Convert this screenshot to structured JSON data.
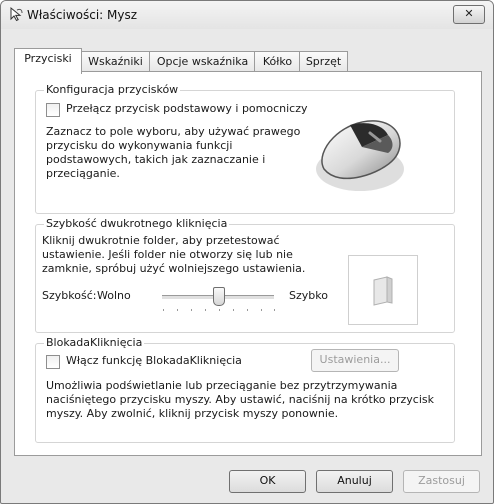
{
  "window": {
    "title": "Właściwości: Mysz",
    "close_label": "✕",
    "icon": "mouse-pointer-icon"
  },
  "tabs": [
    {
      "label": "Przyciski",
      "active": true
    },
    {
      "label": "Wskaźniki",
      "active": false
    },
    {
      "label": "Opcje wskaźnika",
      "active": false
    },
    {
      "label": "Kółko",
      "active": false
    },
    {
      "label": "Sprzęt",
      "active": false
    }
  ],
  "button_config": {
    "legend": "Konfiguracja przycisków",
    "checkbox_label": "Przełącz przycisk podstawowy i pomocniczy",
    "checked": false,
    "description_lines": [
      "Zaznacz to pole wyboru, aby używać prawego",
      "przycisku do wykonywania funkcji",
      "podstawowych, takich jak zaznaczanie i",
      "przeciąganie."
    ],
    "image": "mouse-icon"
  },
  "double_click": {
    "legend": "Szybkość dwukrotnego kliknięcia",
    "description_lines": [
      "Kliknij dwukrotnie folder, aby przetestować",
      "ustawienie. Jeśli folder nie otworzy się lub nie",
      "zamknie, spróbuj użyć wolniejszego ustawienia."
    ],
    "speed_label": "Szybkość:",
    "slow_label": "Wolno",
    "fast_label": "Szybko",
    "slider_value": 0.5,
    "test_icon": "folder-icon"
  },
  "click_lock": {
    "legend": "BlokadaKliknięcia",
    "checkbox_label": "Włącz funkcję BlokadaKliknięcia",
    "checked": false,
    "settings_label": "Ustawienia...",
    "description_lines": [
      "Umożliwia podświetlanie lub przeciąganie bez przytrzymywania",
      "naciśniętego przycisku myszy. Aby ustawić, naciśnij na krótko przycisk",
      "myszy. Aby zwolnić, kliknij przycisk myszy ponownie."
    ]
  },
  "footer": {
    "ok_label": "OK",
    "cancel_label": "Anuluj",
    "apply_label": "Zastosuj"
  }
}
